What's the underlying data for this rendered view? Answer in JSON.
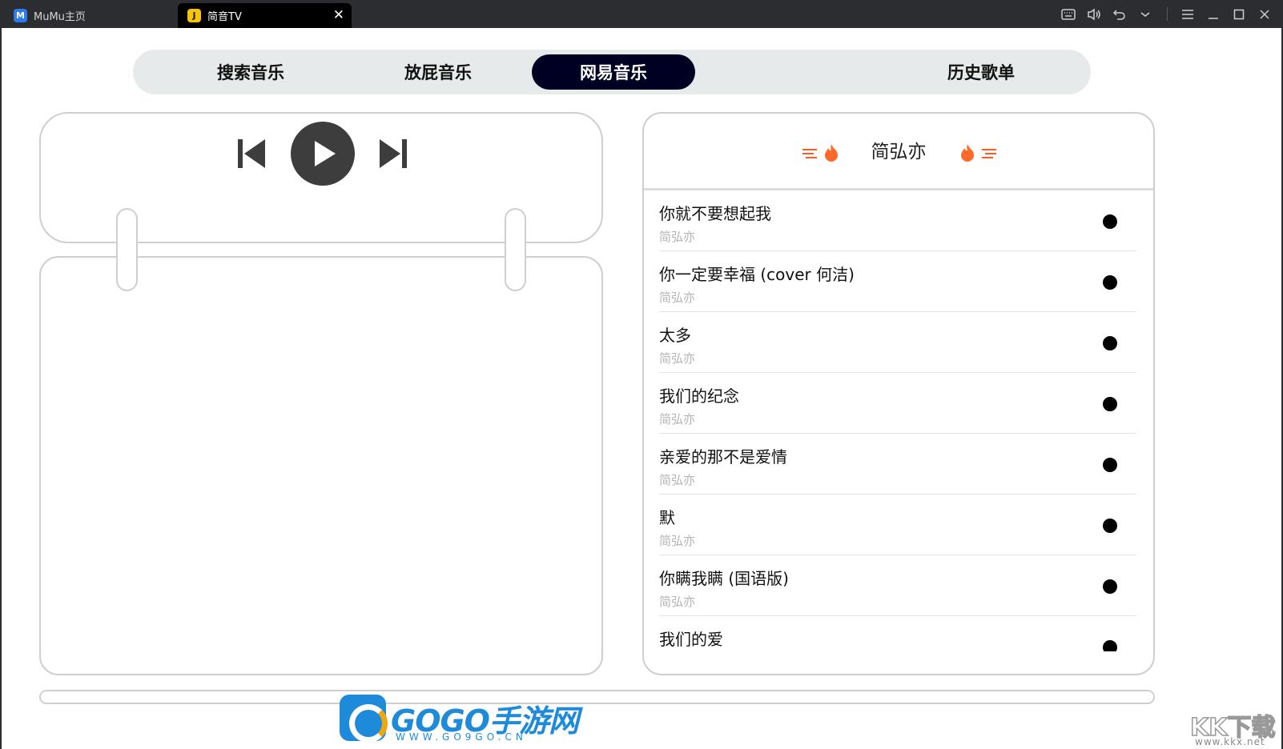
{
  "window": {
    "tabs": [
      {
        "label": "MuMu主页",
        "icon": "mumu-logo-icon",
        "active": false
      },
      {
        "label": "简音TV",
        "icon": "app-logo-icon",
        "active": true
      }
    ],
    "controls": [
      "keyboard-icon",
      "volume-icon",
      "undo-icon",
      "chevron-down-icon",
      "menu-icon",
      "minimize-icon",
      "maximize-icon",
      "close-icon"
    ]
  },
  "nav": {
    "tabs": [
      {
        "label": "搜索音乐",
        "active": false
      },
      {
        "label": "放屁音乐",
        "active": false
      },
      {
        "label": "网易音乐",
        "active": true
      },
      {
        "label": "历史歌单",
        "active": false
      }
    ]
  },
  "player": {
    "controls": [
      "previous-icon",
      "play-icon",
      "next-icon"
    ],
    "accent": "#3d3d3d",
    "progress": 0
  },
  "playlist": {
    "title": "简弘亦",
    "songs": [
      {
        "title": "你就不要想起我",
        "artist": "简弘亦"
      },
      {
        "title": "你一定要幸福 (cover 何洁)",
        "artist": "简弘亦"
      },
      {
        "title": "太多",
        "artist": "简弘亦"
      },
      {
        "title": "我们的纪念",
        "artist": "简弘亦"
      },
      {
        "title": "亲爱的那不是爱情",
        "artist": "简弘亦"
      },
      {
        "title": "默",
        "artist": "简弘亦"
      },
      {
        "title": "你瞒我瞒 (国语版)",
        "artist": "简弘亦"
      },
      {
        "title": "我们的爱",
        "artist": ""
      }
    ]
  },
  "colors": {
    "active_tab": "#000022",
    "nav_bg": "#e6eaea",
    "border": "#cfcfcf",
    "muted": "#b4b4b4",
    "fire": "#ff5a1f"
  },
  "watermarks": {
    "gogo_text": "GOGO手游网",
    "gogo_url": "WWW.GO9GO.CN",
    "kk_text": "KK下载",
    "kk_url": "www.kkx.net"
  }
}
